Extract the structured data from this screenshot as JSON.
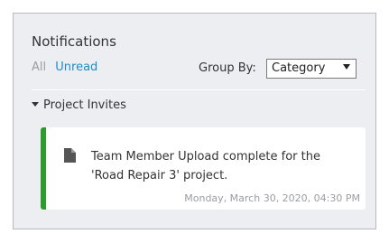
{
  "panel": {
    "title": "Notifications",
    "filters": {
      "all": "All",
      "unread": "Unread"
    },
    "group_by": {
      "label": "Group By:",
      "selected": "Category"
    },
    "groups": [
      {
        "name": "Project Invites",
        "notifications": [
          {
            "icon": "document-icon",
            "message": "Team Member Upload complete for the 'Road Repair 3' project.",
            "timestamp": "Monday, March 30, 2020, 04:30 PM",
            "accent_color": "#2a9c2a"
          }
        ]
      }
    ]
  },
  "colors": {
    "panel_bg": "#eceef2",
    "link": "#1a8fc4",
    "muted": "#9a9da2"
  }
}
